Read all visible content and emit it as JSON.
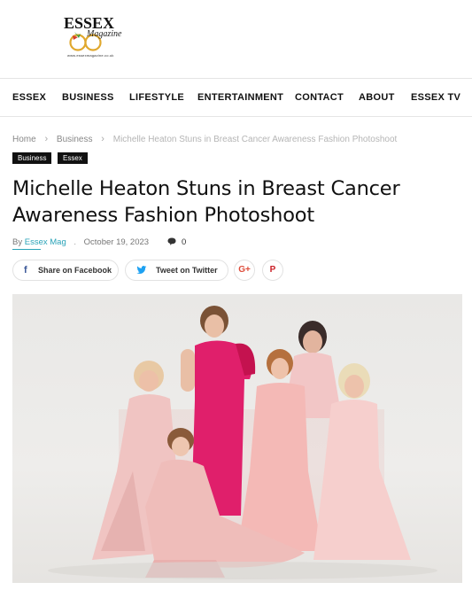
{
  "logo": {
    "wordmark": "ESSEX",
    "sub": "Magazine",
    "url": "www.essexmagazine.co.uk"
  },
  "nav": {
    "items": [
      {
        "label": "ESSEX"
      },
      {
        "label": "BUSINESS"
      },
      {
        "label": "LIFESTYLE"
      },
      {
        "label": "ENTERTAINMENT"
      },
      {
        "label": "CONTACT"
      },
      {
        "label": "ABOUT"
      },
      {
        "label": "ESSEX TV"
      }
    ]
  },
  "breadcrumb": {
    "home": "Home",
    "section": "Business",
    "current": "Michelle Heaton Stuns in Breast Cancer Awareness Fashion Photoshoot"
  },
  "tags": [
    "Business",
    "Essex"
  ],
  "article": {
    "title": "Michelle Heaton Stuns in Breast Cancer Awareness Fashion Photoshoot",
    "by": "By",
    "author": "Essex Mag",
    "date": "October 19, 2023",
    "comments": "0"
  },
  "share": {
    "facebook": "Share on Facebook",
    "twitter": "Tweet on Twitter",
    "gplus": "G+",
    "pinterest": "P"
  },
  "colors": {
    "accent": "#2aa3b8",
    "facebook": "#3b5998",
    "twitter": "#1da1f2",
    "gplus": "#dd4b39",
    "pinterest": "#cb2027"
  },
  "photo": {
    "icon": "featured-photo"
  }
}
